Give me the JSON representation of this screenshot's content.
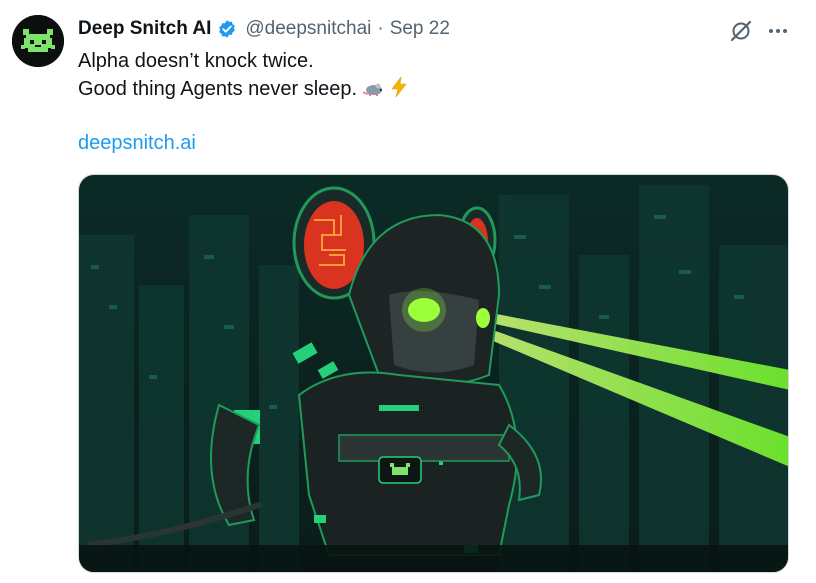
{
  "tweet": {
    "author_name": "Deep Snitch AI",
    "handle": "@deepsnitchai",
    "separator": "·",
    "date": "Sep 22",
    "line1": "Alpha doesn’t knock twice.",
    "line2": "Good thing Agents never sleep.",
    "link": "deepsnitch.ai"
  },
  "icons": {
    "verified": "verified-badge-icon",
    "grok": "grok-icon",
    "more": "more-options-icon",
    "emoji_rat": "rat-emoji",
    "emoji_bolt": "lightning-emoji"
  },
  "colors": {
    "verified": "#1d9bf0",
    "link": "#1d9bf0",
    "secondary_text": "#536471",
    "laser_green": "#7cff2e"
  }
}
